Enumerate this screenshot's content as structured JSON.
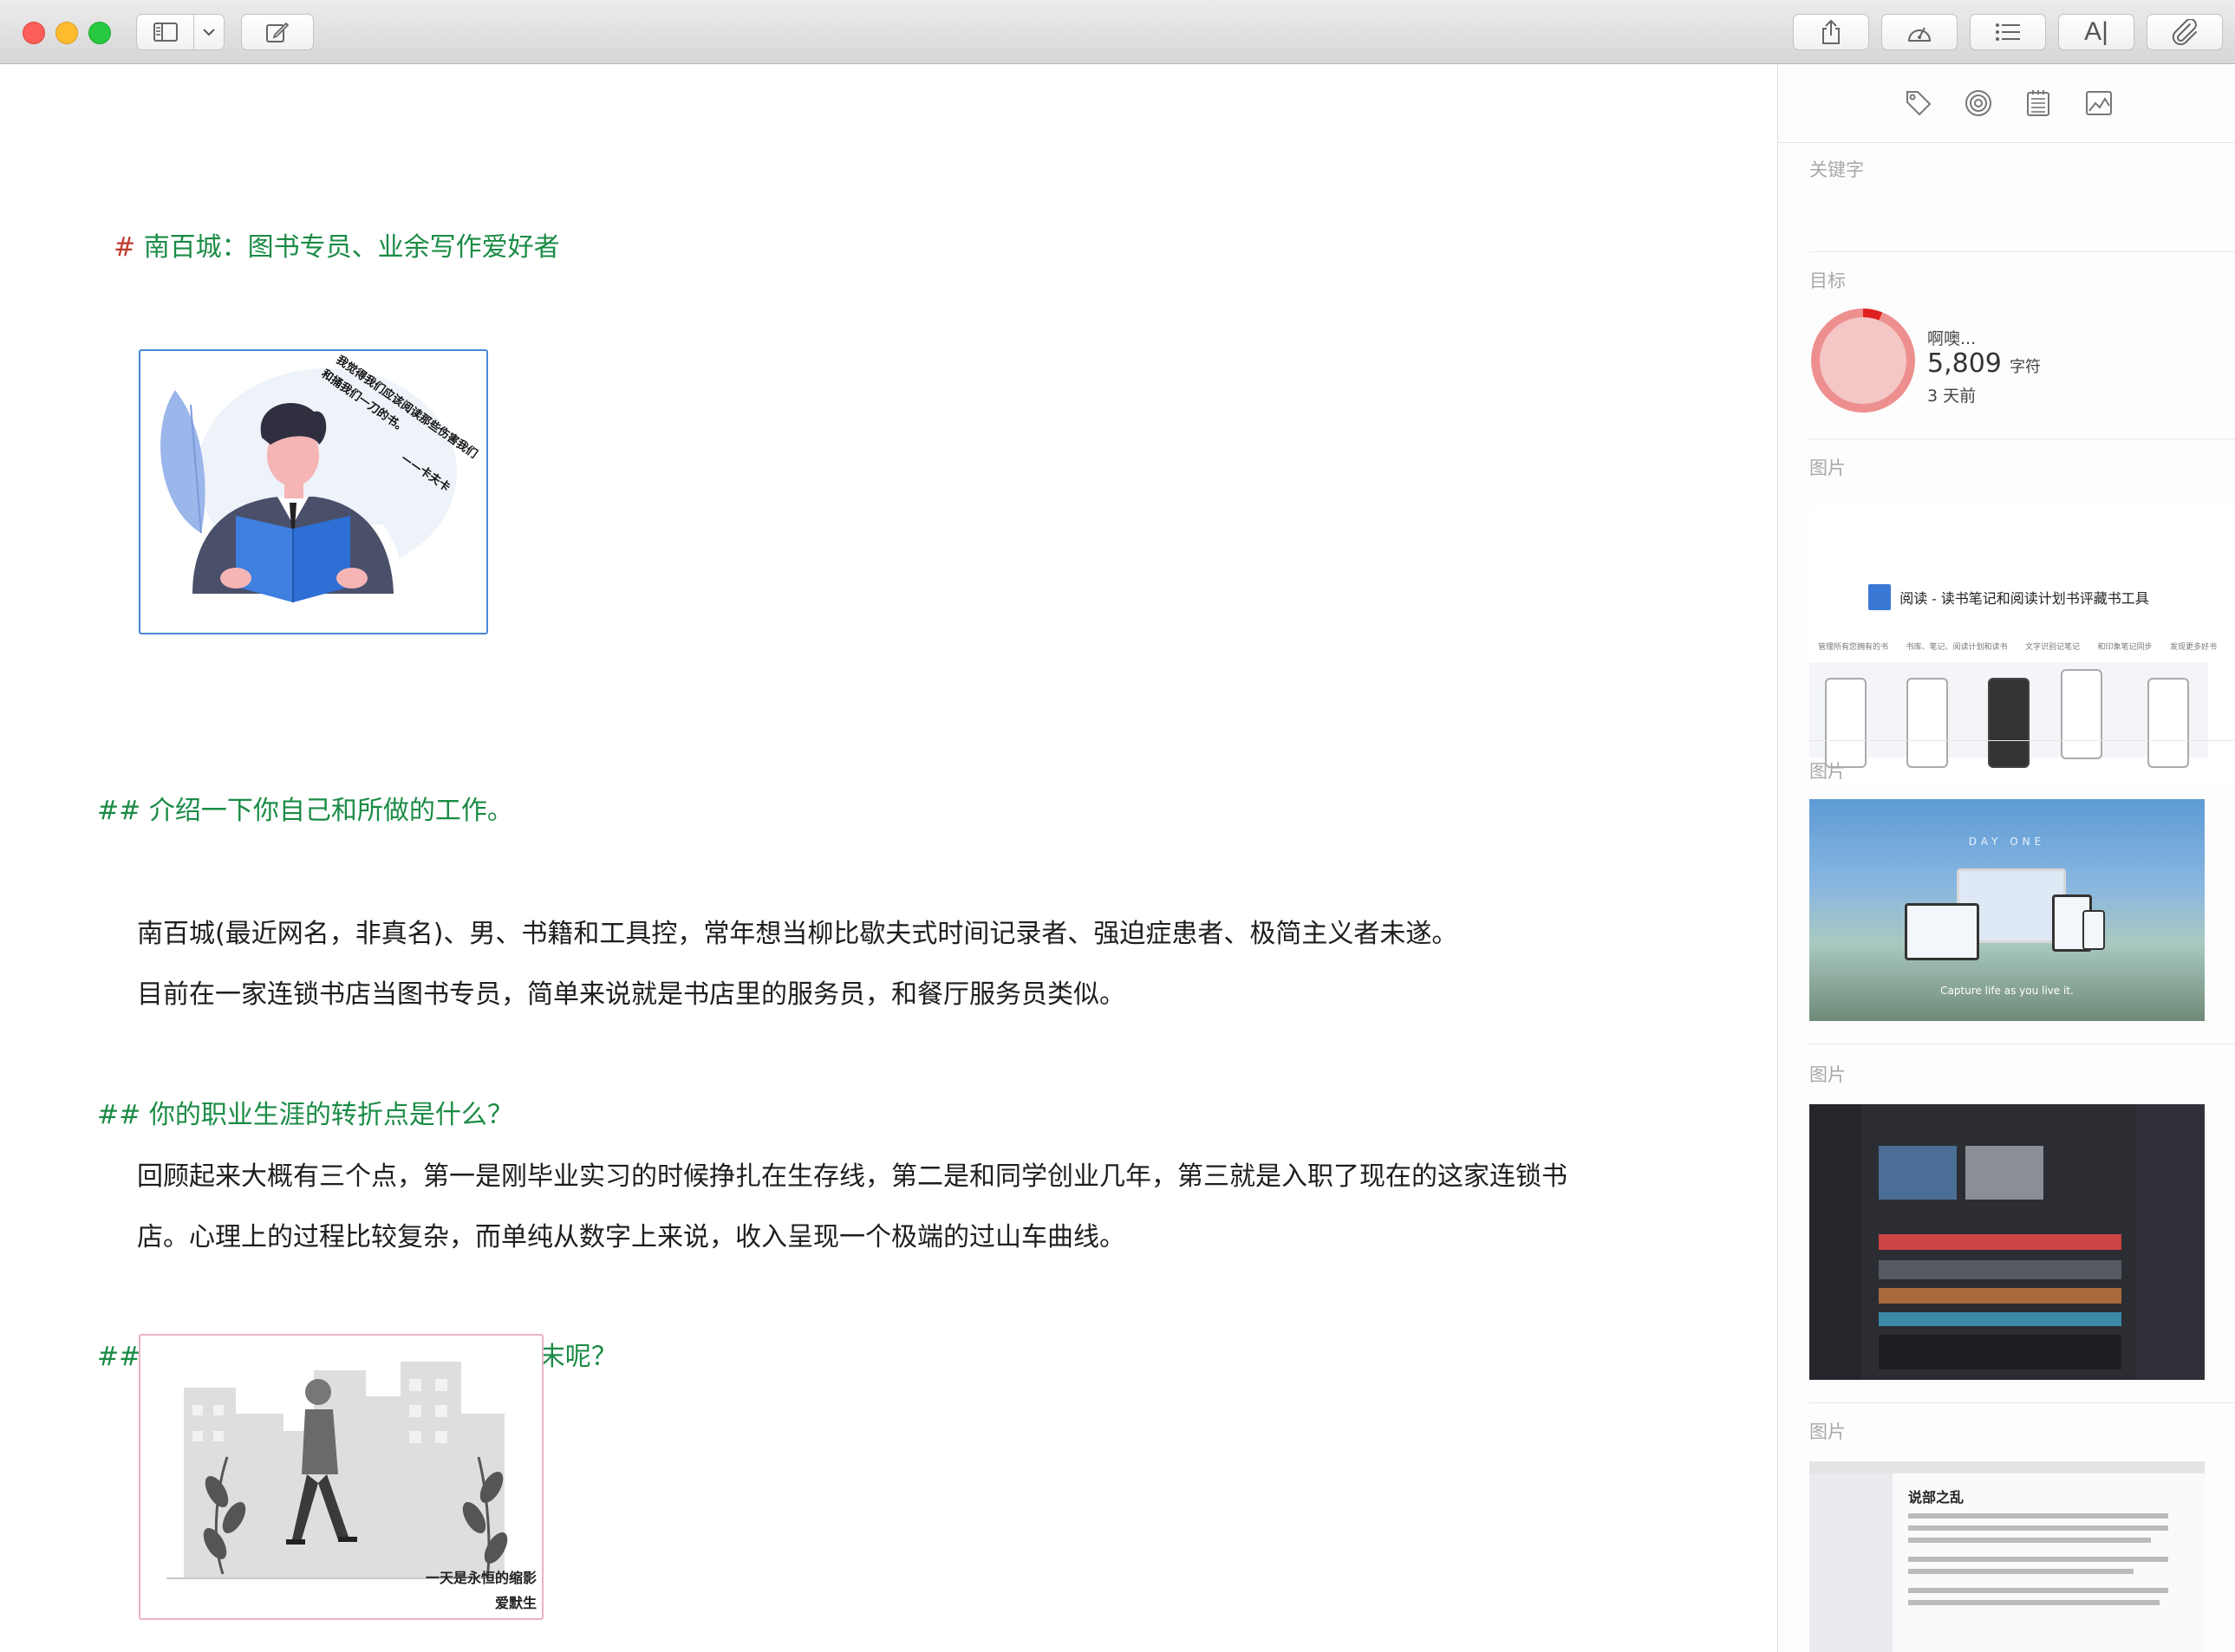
{
  "toolbar": {
    "icons": [
      "sidebar-icon",
      "chevron-down-icon",
      "compose-icon",
      "share-icon",
      "speedometer-icon",
      "list-icon",
      "text-style-icon",
      "paperclip-icon"
    ]
  },
  "document": {
    "h1_marker": "#",
    "h1_text": "南百城：图书专员、业余写作爱好者",
    "img1_caption_1": "我觉得我们应该阅读那些伤害我们",
    "img1_caption_2": "和捅我们一刀的书。",
    "img1_caption_3": "——卡夫卡",
    "h2_marker": "##",
    "h2_1": "介绍一下你自己和所做的工作。",
    "p1_l1": "南百城(最近网名，非真名)、男、书籍和工具控，常年想当柳比歇夫式时间记录者、强迫症患者、极简主义者未遂。",
    "p1_l2": "目前在一家连锁书店当图书专员，简单来说就是书店里的服务员，和餐厅服务员类似。",
    "h2_2": "你的职业生涯的转折点是什么？",
    "p2_l1": "回顾起来大概有三个点，第一是刚毕业实习的时候挣扎在生存线，第二是和同学创业几年，第三就是入职了现在的这家连锁书",
    "p2_l2": "店。心理上的过程比较复杂，而单纯从数字上来说，收入呈现一个极端的过山车曲线。",
    "h2_3": "工作中的一天你是怎样度过的？周末呢？",
    "img2_caption_1": "一天是永恒的缩影",
    "img2_caption_2": "爱默生"
  },
  "panel": {
    "tabs": [
      "tag-icon",
      "target-icon",
      "notes-icon",
      "image-icon"
    ],
    "keywords_label": "关键字",
    "goal_label": "目标",
    "goal_status": "啊噢...",
    "goal_count": "5,809",
    "goal_unit": "字符",
    "goal_time": "3 天前",
    "goal_progress": 0.06,
    "images_label": "图片",
    "thumb1_title": "阅读 - 读书笔记和阅读计划书评藏书工具",
    "thumb1_cols": [
      "管理所有您拥有的书",
      "书库、笔记、阅读计划和读书",
      "文字识别记笔记",
      "和印象笔记同步",
      "发现更多好书"
    ],
    "thumb2_brand": "DAY ONE",
    "thumb2_tagline": "Capture life as you live it.",
    "thumb4_title": "说部之乱"
  },
  "colors": {
    "heading_green": "#1a8b45",
    "h1_marker_red": "#c0392b",
    "ring_red": "#e02020",
    "ring_fill": "#f4c6c6"
  }
}
